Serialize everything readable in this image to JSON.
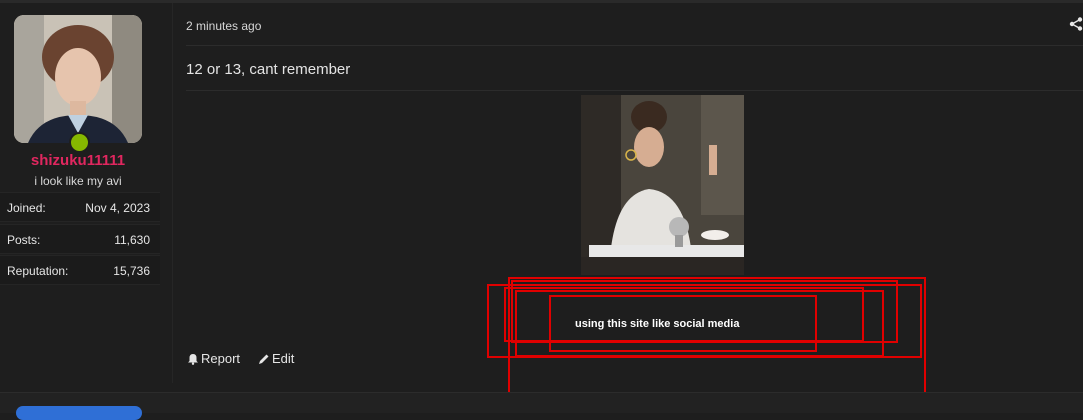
{
  "post": {
    "timestamp": "2 minutes ago",
    "message": "12 or 13, cant remember",
    "caption": "using this site like social media",
    "actions": {
      "report_label": "Report",
      "edit_label": "Edit"
    }
  },
  "user": {
    "name": "shizuku11111",
    "title": "i look like my avi",
    "stats": [
      {
        "label": "Joined:",
        "value": "Nov 4, 2023"
      },
      {
        "label": "Posts:",
        "value": "11,630"
      },
      {
        "label": "Reputation:",
        "value": "15,736"
      }
    ]
  },
  "colors": {
    "username": "#e0275f",
    "online": "#86b800",
    "annotation": "#e00000"
  }
}
